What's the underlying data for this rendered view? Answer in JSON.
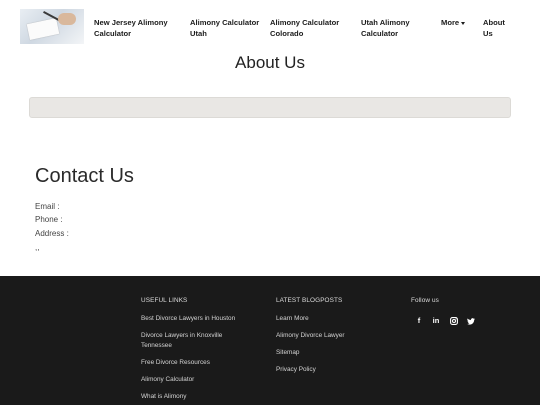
{
  "nav": {
    "items": [
      {
        "label": "New Jersey Alimony Calculator"
      },
      {
        "label": "Alimony Calculator Utah"
      },
      {
        "label": "Alimony Calculator Colorado"
      },
      {
        "label": "Utah Alimony Calculator"
      },
      {
        "label": "About Us"
      }
    ],
    "more_label": "More"
  },
  "page": {
    "title": "About Us"
  },
  "contact": {
    "title": "Contact Us",
    "email_label": "Email :",
    "phone_label": "Phone :",
    "address_label": "Address :",
    "extra": ",,"
  },
  "footer": {
    "useful_links_heading": "USEFUL LINKS",
    "useful_links": [
      "Best Divorce Lawyers in Houston",
      "Divorce Lawyers in Knoxville Tennessee",
      "Free Divorce Resources",
      "Alimony Calculator",
      "What is Alimony"
    ],
    "blogposts_heading": "LATEST BLOGPOSTS",
    "blogposts": [
      "Learn More",
      "Alimony Divorce Lawyer",
      "Sitemap",
      "Privacy Policy"
    ],
    "follow_heading": "Follow us",
    "social_icons": [
      "facebook-icon",
      "linkedin-icon",
      "instagram-icon",
      "twitter-icon"
    ]
  }
}
